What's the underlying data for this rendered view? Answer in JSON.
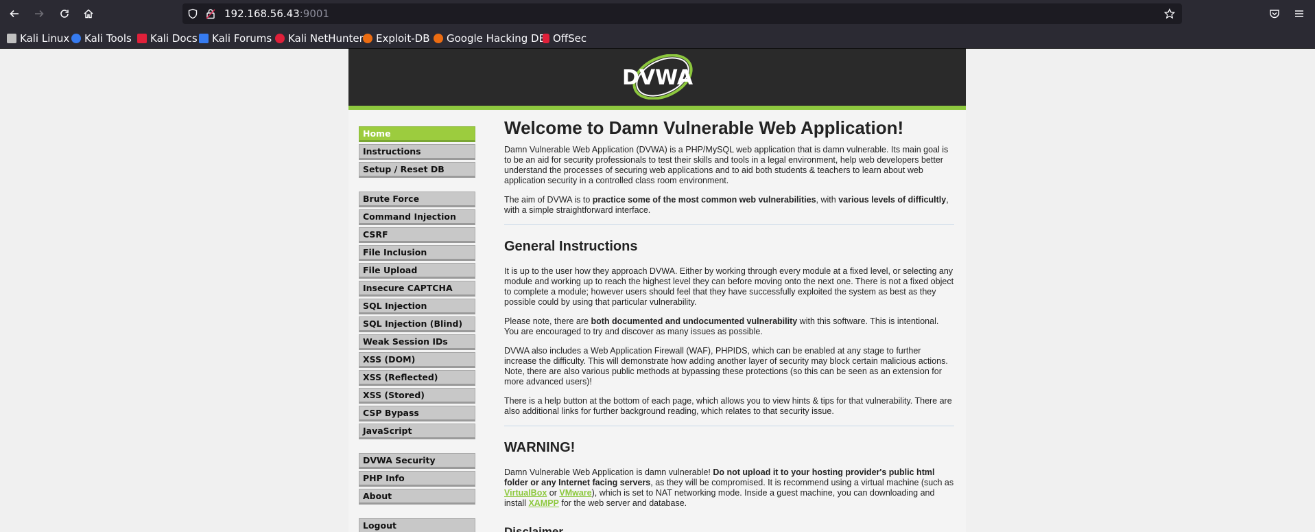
{
  "browser": {
    "url_host": "192.168.56.43",
    "url_port": ":9001",
    "bookmarks": [
      {
        "label": "Kali Linux",
        "icon": "kali-dragon-icon",
        "color": "#c0c0c0"
      },
      {
        "label": "Kali Tools",
        "icon": "kali-tools-icon",
        "color": "#367bf0"
      },
      {
        "label": "Kali Docs",
        "icon": "kali-docs-icon",
        "color": "#e0203a"
      },
      {
        "label": "Kali Forums",
        "icon": "kali-forums-icon",
        "color": "#367bf0"
      },
      {
        "label": "Kali NetHunter",
        "icon": "nethunter-icon",
        "color": "#e0203a"
      },
      {
        "label": "Exploit-DB",
        "icon": "exploit-db-icon",
        "color": "#ec6c12"
      },
      {
        "label": "Google Hacking DB",
        "icon": "ghdb-icon",
        "color": "#ec6c12"
      },
      {
        "label": "OffSec",
        "icon": "offsec-icon",
        "color": "#e0203a"
      }
    ]
  },
  "header": {
    "logo_text": "DVWA",
    "accent": "#8dc83e"
  },
  "menu": {
    "groups": [
      [
        "Home",
        "Instructions",
        "Setup / Reset DB"
      ],
      [
        "Brute Force",
        "Command Injection",
        "CSRF",
        "File Inclusion",
        "File Upload",
        "Insecure CAPTCHA",
        "SQL Injection",
        "SQL Injection (Blind)",
        "Weak Session IDs",
        "XSS (DOM)",
        "XSS (Reflected)",
        "XSS (Stored)",
        "CSP Bypass",
        "JavaScript"
      ],
      [
        "DVWA Security",
        "PHP Info",
        "About"
      ],
      [
        "Logout"
      ]
    ],
    "selected": "Home"
  },
  "main": {
    "title": "Welcome to Damn Vulnerable Web Application!",
    "intro1": "Damn Vulnerable Web Application (DVWA) is a PHP/MySQL web application that is damn vulnerable. Its main goal is to be an aid for security professionals to test their skills and tools in a legal environment, help web developers better understand the processes of securing web applications and to aid both students & teachers to learn about web application security in a controlled class room environment.",
    "intro2_a": "The aim of DVWA is to ",
    "intro2_b": "practice some of the most common web vulnerabilities",
    "intro2_c": ", with ",
    "intro2_d": "various levels of difficultly",
    "intro2_e": ", with a simple straightforward interface.",
    "general_heading": "General Instructions",
    "gen1": "It is up to the user how they approach DVWA. Either by working through every module at a fixed level, or selecting any module and working up to reach the highest level they can before moving onto the next one. There is not a fixed object to complete a module; however users should feel that they have successfully exploited the system as best as they possible could by using that particular vulnerability.",
    "gen2_a": "Please note, there are ",
    "gen2_b": "both documented and undocumented vulnerability",
    "gen2_c": " with this software. This is intentional. You are encouraged to try and discover as many issues as possible.",
    "gen3": "DVWA also includes a Web Application Firewall (WAF), PHPIDS, which can be enabled at any stage to further increase the difficulty. This will demonstrate how adding another layer of security may block certain malicious actions. Note, there are also various public methods at bypassing these protections (so this can be seen as an extension for more advanced users)!",
    "gen4": "There is a help button at the bottom of each page, which allows you to view hints & tips for that vulnerability. There are also additional links for further background reading, which relates to that security issue.",
    "warning_heading": "WARNING!",
    "warn_a": "Damn Vulnerable Web Application is damn vulnerable! ",
    "warn_b": "Do not upload it to your hosting provider's public html folder or any Internet facing servers",
    "warn_c": ", as they will be compromised. It is recommend using a virtual machine (such as ",
    "warn_link1": "VirtualBox",
    "warn_d": " or ",
    "warn_link2": "VMware",
    "warn_e": "), which is set to NAT networking mode. Inside a guest machine, you can downloading and install ",
    "warn_link3": "XAMPP",
    "warn_f": " for the web server and database.",
    "disclaimer_heading": "Disclaimer"
  }
}
